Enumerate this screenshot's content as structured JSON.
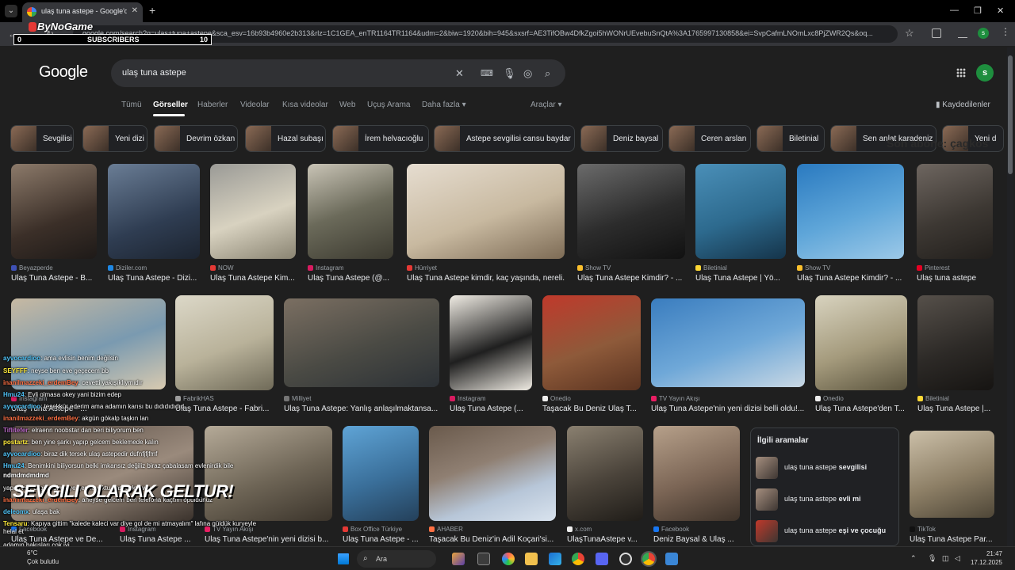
{
  "browser": {
    "tab_title": "ulaş tuna astepe - Google'da A",
    "url": "google.com/search?q=ulaş+tuna+astepe&sca_esv=16b93b4960e2b313&rlz=1C1GEA_enTR1164TR1164&udm=2&biw=1920&bih=945&sxsrf=AE3TifOBw4DfkZgoi5hWONrUEvebuSnQtA%3A1765997130858&ei=SvpCafmLNOmLxc8PjZWR2Qs&oq...",
    "profile_initial": "s"
  },
  "overlay": {
    "brand": "ByNoGame",
    "sub_min": "0",
    "sub_label": "SUBSCRIBERS",
    "sub_max": "10",
    "last_sub": "Son abone: çagkos",
    "big_text": "SEVGILI OLARAK GELTUR!"
  },
  "google": {
    "logo": "Google",
    "query": "ulaş tuna astepe",
    "profile_initial": "s",
    "tabs": [
      "Tümü",
      "Görseller",
      "Haberler",
      "Videolar",
      "Kısa videolar",
      "Web",
      "Uçuş Arama",
      "Daha fazla ▾",
      "Araçlar ▾"
    ],
    "saved": "Kaydedilenler"
  },
  "chips": [
    "Sevgilisi",
    "Yeni dizi",
    "Devrim özkan",
    "Hazal subaşı",
    "İrem helvacıoğlu",
    "Astepe sevgilisi cansu baydar",
    "Deniz baysal",
    "Ceren arslan",
    "Biletinial",
    "Sen anlat karadeniz",
    "Yeni d"
  ],
  "row1": [
    {
      "source": "Beyazperde",
      "title": "Ulaş Tuna Astepe - B..."
    },
    {
      "source": "Diziler.com",
      "title": "Ulaş Tuna Astepe - Dizi..."
    },
    {
      "source": "NOW",
      "title": "Ulaş Tuna Astepe Kim..."
    },
    {
      "source": "Instagram",
      "title": "Ulaş Tuna Astepe (@..."
    },
    {
      "source": "Hürriyet",
      "title": "Ulaş Tuna Astepe kimdir, kaç yaşında, nereli..."
    },
    {
      "source": "Show TV",
      "title": "Ulaş Tuna Astepe Kimdir? - ..."
    },
    {
      "source": "Biletinial",
      "title": "Ulaş Tuna Astepe | Yö..."
    },
    {
      "source": "Show TV",
      "title": "Ulaş Tuna Astepe Kimdir? - ..."
    },
    {
      "source": "Pinterest",
      "title": "Ulaş tuna astepe"
    }
  ],
  "row2": [
    {
      "source": "Instagram",
      "title": "Ulaş Tuna Astepe - ..."
    },
    {
      "source": "FabrikHAS",
      "title": "Ulaş Tuna Astepe - Fabri..."
    },
    {
      "source": "Milliyet",
      "title": "Ulaş Tuna Astepe: Yanlış anlaşılmaktansa..."
    },
    {
      "source": "Instagram",
      "title": "Ulaş Tuna Astepe (..."
    },
    {
      "source": "Onedio",
      "title": "Taşacak Bu Deniz Ulaş T..."
    },
    {
      "source": "TV Yayın Akışı",
      "title": "Ulaş Tuna Astepe'nin yeni dizisi belli oldu!..."
    },
    {
      "source": "Onedio",
      "title": "Ulaş Tuna Astepe'den T..."
    },
    {
      "source": "Biletinial",
      "title": "Ulaş Tuna Astepe |..."
    }
  ],
  "row3": [
    {
      "source": "Facebook",
      "title": "Ulaş Tuna Astepe ve De..."
    },
    {
      "source": "Instagram",
      "title": "Ulaş Tuna Astepe ..."
    },
    {
      "source": "TV Yayın Akışı",
      "title": "Ulaş Tuna Astepe'nin yeni dizisi b..."
    },
    {
      "source": "Box Office Türkiye",
      "title": "Ulaş Tuna Astepe - ..."
    },
    {
      "source": "AHABER",
      "title": "Taşacak Bu Deniz'in Adil Koçari'si..."
    },
    {
      "source": "x.com",
      "title": "UlaşTunaAstepe v..."
    },
    {
      "source": "Facebook",
      "title": "Deniz Baysal & Ulaş ..."
    },
    {
      "source": "TikTok",
      "title": "Ulaş Tuna Astepe Par..."
    }
  ],
  "related": {
    "title": "İlgili aramalar",
    "items": [
      {
        "prefix": "ulaş tuna astepe ",
        "bold": "sevgilisi"
      },
      {
        "prefix": "ulaş tuna astepe ",
        "bold": "evli mi"
      },
      {
        "prefix": "ulaş tuna astepe ",
        "bold": "eşi ve çocuğu"
      }
    ]
  },
  "chat": [
    {
      "user": "ayvocardioo",
      "msg": ": ama evlisin benim değilsin",
      "color": "#4fc3f7"
    },
    {
      "user": "SEYFFF",
      "msg": ": neyse ben eve geçecem bb",
      "color": "#ffeb3b"
    },
    {
      "user": "inanilmazzeki_erdemBey",
      "msg": ": cevetti yakışıklıymıdır",
      "color": "#ff7043"
    },
    {
      "user": "Hmu24",
      "msg": ": Evli olmasa okey yani bizim edep",
      "color": "#4fc3f7"
    },
    {
      "user": "ayvocardioo",
      "msg": ": teşekkür ederim ama adamın karısı bu dıdıdıdıdıd",
      "color": "#4fc3f7"
    },
    {
      "user": "inanilmazzeki_erdemBey",
      "msg": ": akgün gökalp taşkın lan",
      "color": "#ff7043"
    },
    {
      "user": "Tiflitefer",
      "msg": ": elraenn noobstar dan beri biliyorum ben",
      "color": "#ba68c8"
    },
    {
      "user": "postartz",
      "msg": ": ben yine şarkı yapıp gelcem beklemede kalın",
      "color": "#ffeb3b"
    },
    {
      "user": "ayvocardioo",
      "msg": ": biraz dik tersek ulaş astepedir dufnfjfjfmf",
      "color": "#4fc3f7"
    },
    {
      "user": "Hmu24",
      "msg": ": Benimkini biliyorsun belki imkansız değiliz biraz çabalasam evlenirdik bile",
      "color": "#4fc3f7"
    },
    {
      "user": "ndmdmdmdmd",
      "msg": "",
      "color": "#ffffff"
    },
    {
      "user": "",
      "msg": "yapıla bile bilgilendirmeye gerek yoktu haşkaşkuşw",
      "color": "#ffffff"
    },
    {
      "user": "inanilmazzeki_erdemBey",
      "msg": ": aneyse gelcem ben telefona kaçtım opuldünüz",
      "color": "#ff7043"
    },
    {
      "user": "deleomx",
      "msg": ": ulaşa bak",
      "color": "#4fc3f7"
    },
    {
      "user": "Tensaru",
      "msg": ": Kapıya gittim \"kalede kaleci var diye gol de mi atmayalım\" lafına güldük kuryeyle helal et",
      "color": "#ffeb3b"
    },
    {
      "user": "",
      "msg": "adamın bakışları çok iyi",
      "color": "#ffffff"
    }
  ],
  "taskbar": {
    "temp": "6°C",
    "weather": "Çok bulutlu",
    "search": "Ara",
    "time": "21:47",
    "date": "17.12.2025"
  }
}
